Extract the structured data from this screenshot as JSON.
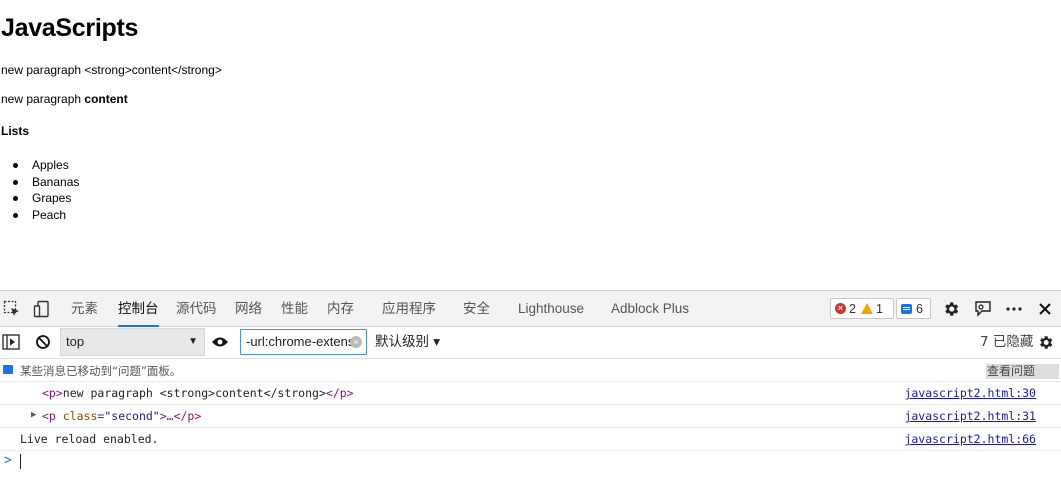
{
  "page": {
    "heading": "JavaScripts",
    "para1": "new paragraph <strong>content</strong>",
    "para2_text": "new paragraph ",
    "para2_strong": "content",
    "lists_heading": "Lists",
    "list_items": [
      "Apples",
      "Bananas",
      "Grapes",
      "Peach"
    ]
  },
  "devtools": {
    "tabs": [
      "元素",
      "控制台",
      "源代码",
      "网络",
      "性能",
      "内存",
      "应用程序",
      "安全",
      "Lighthouse",
      "Adblock Plus"
    ],
    "active_tab": "控制台",
    "errors_count": "2",
    "warnings_count": "1",
    "messages_count": "6",
    "icons": {
      "inspect": "inspect-element-icon",
      "device": "device-toolbar-icon",
      "settings": "gear-icon",
      "feedback": "feedback-icon",
      "more": "more-icon",
      "close": "close-icon"
    },
    "accent_color": "#1a73e8",
    "toolbar": {
      "context": "top",
      "filter_value": "-url:chrome-extens",
      "levels": "默认级别 ▾",
      "hidden": "7 已隐藏"
    },
    "console": {
      "info_message": "某些消息已移动到“问题”面板。",
      "info_button": "查看问题",
      "rows": [
        {
          "tag_open": "<p>",
          "text": "new paragraph <strong>content</strong>",
          "tag_close": "</p>",
          "source": "javascript2.html:30"
        },
        {
          "prefix": "<p ",
          "attr": "class",
          "attr_eq": "=",
          "attr_val": "\"second\"",
          "suffix": ">…</p>",
          "source": "javascript2.html:31"
        },
        {
          "text": "Live reload enabled.",
          "source": "javascript2.html:66"
        }
      ],
      "prompt": ">"
    }
  }
}
